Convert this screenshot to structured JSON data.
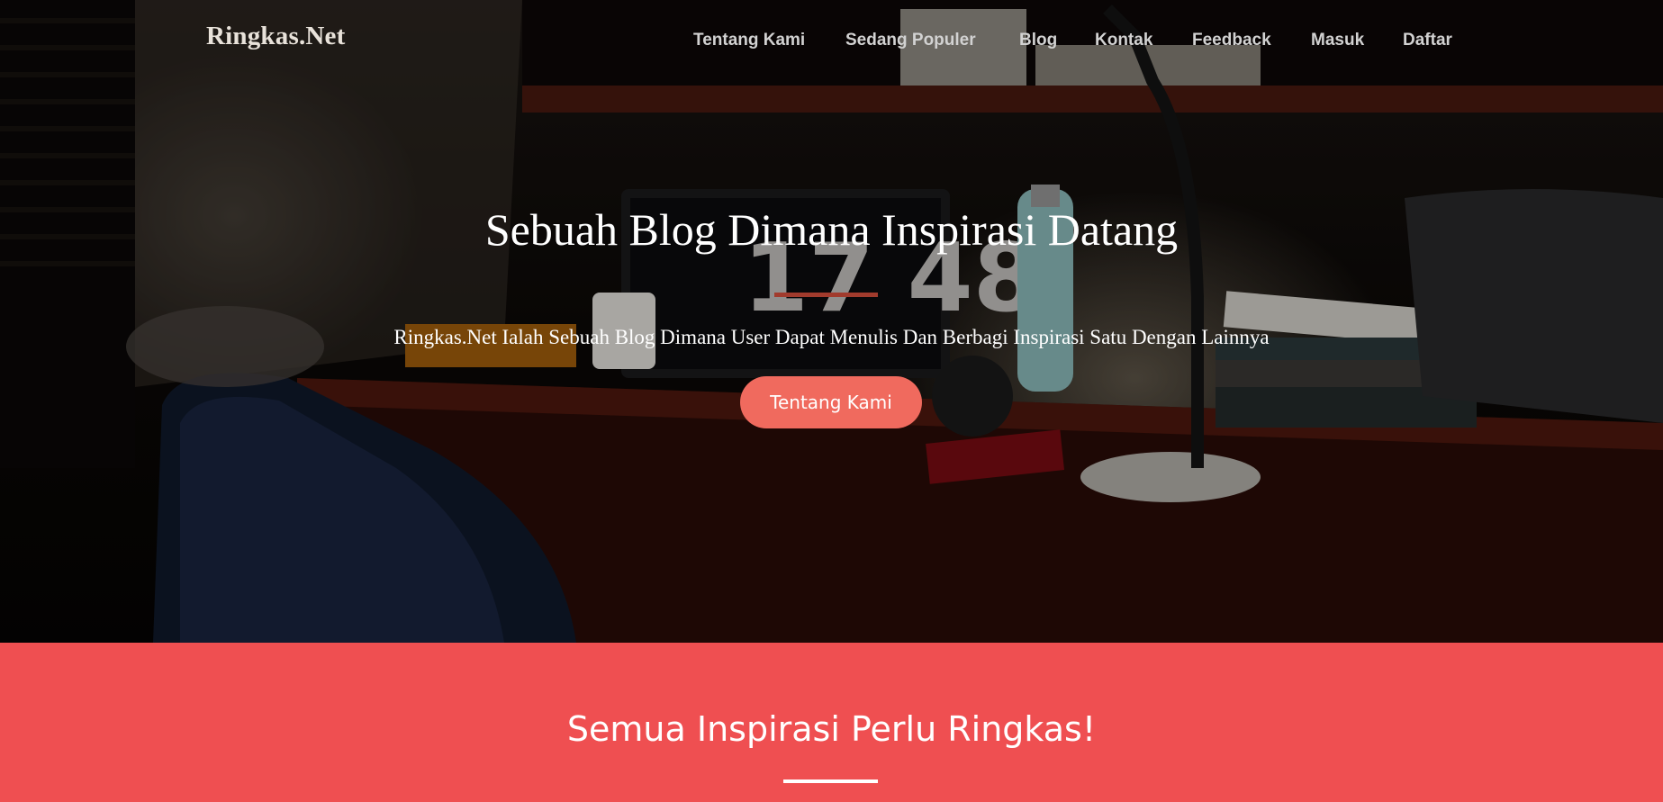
{
  "brand": {
    "name": "Ringkas.Net"
  },
  "nav": {
    "items": [
      {
        "label": "Tentang Kami"
      },
      {
        "label": "Sedang Populer"
      },
      {
        "label": "Blog"
      },
      {
        "label": "Kontak"
      },
      {
        "label": "Feedback"
      },
      {
        "label": "Masuk"
      },
      {
        "label": "Daftar"
      }
    ]
  },
  "hero": {
    "title": "Sebuah Blog Dimana Inspirasi Datang",
    "subtitle": "Ringkas.Net Ialah Sebuah Blog Dimana User Dapat Menulis Dan Berbagi Inspirasi Satu Dengan Lainnya",
    "button_label": "Tentang Kami",
    "clock_text": "17 48"
  },
  "section": {
    "title": "Semua Inspirasi Perlu Ringkas!"
  },
  "colors": {
    "accent": "#f06a5e",
    "section_bg": "#ef4f51",
    "nav_text": "#d2d2d2"
  }
}
